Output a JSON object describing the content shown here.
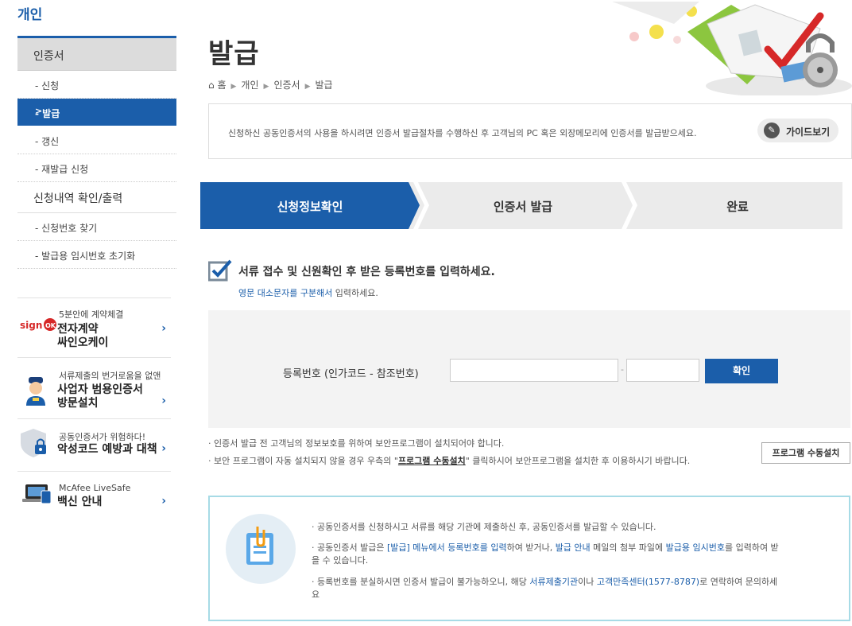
{
  "section_title": "개인",
  "sidebar": {
    "group1": "인증서",
    "items1": [
      "- 신청",
      "- 발급",
      "- 갱신",
      "- 재발급 신청"
    ],
    "group2": "신청내역 확인/출력",
    "items2": [
      "- 신청번호 찾기",
      "- 발급용 임시번호 초기화"
    ],
    "active_arrow": ">"
  },
  "promos": [
    {
      "logo": "sign",
      "small": "5분안에 계약체결",
      "big1": "전자계약",
      "big2": "싸인오케이"
    },
    {
      "small": "서류제출의 번거로움을 없앤",
      "big1": "사업자 범용인증서",
      "big2": "방문설치"
    },
    {
      "small": "공동인증서가 위험하다!",
      "big1": "악성코드 예방과 대책",
      "big2": ""
    },
    {
      "small": "McAfee LiveSafe",
      "big1": "백신 안내",
      "big2": ""
    }
  ],
  "page_title": "발급",
  "breadcrumb": [
    "홈",
    "개인",
    "인증서",
    "발급"
  ],
  "info_text": "신청하신 공동인증서의 사용을 하시려면 인증서 발급절차를 수행하신 후 고객님의 PC 혹은 외장메모리에 인증서를 발급받으세요.",
  "guide_button": "가이드보기",
  "steps": [
    "신청정보확인",
    "인증서 발급",
    "완료"
  ],
  "instruction": {
    "main": "서류 접수 및 신원확인 후 받은 등록번호를 입력하세요.",
    "sub_highlight": "영문 대소문자를 구분해서",
    "sub_rest": " 입력하세요."
  },
  "form": {
    "label": "등록번호 (인가코드 - 참조번호)",
    "code_value": "",
    "ref_value": "",
    "separator": "-",
    "confirm": "확인"
  },
  "notices": {
    "line1": "· 인증서 발급 전 고객님의 정보보호를 위하여 보안프로그램이 설치되어야 합니다.",
    "line2_pre": "· 보안 프로그램이 자동 설치되지 않을 경우 우측의 \"",
    "line2_bold": "프로그램 수동설치",
    "line2_post": "\" 클릭하시어 보안프로그램을 설치한 후 이용하시기 바랍니다.",
    "manual_button": "프로그램 수동설치"
  },
  "bottom": {
    "b1": "· 공동인증서를 신청하시고 서류를 해당 기관에 제출하신 후, 공동인증서를 발급할 수 있습니다.",
    "b2_a": "· 공동인증서 발급은 ",
    "b2_b": "[발급] 메뉴에서 등록번호를 입력",
    "b2_c": "하여 받거나, ",
    "b2_d": "발급 안내",
    "b2_e": " 메일의 첨부 파일에 ",
    "b2_f": "발급용 임시번호",
    "b2_g": "를 입력하여 받을 수 있습니다.",
    "b3_a": "· 등록번호를 분실하시면 인증서 발급이 불가능하오니, 해당 ",
    "b3_b": "서류제출기관",
    "b3_c": "이나 ",
    "b3_d": "고객만족센터(1577-8787)",
    "b3_e": "로 연락하여 문의하세요"
  },
  "colors": {
    "primary": "#1b5eaa",
    "step_inactive": "#ebebeb",
    "border_light": "#a7dbe6"
  }
}
